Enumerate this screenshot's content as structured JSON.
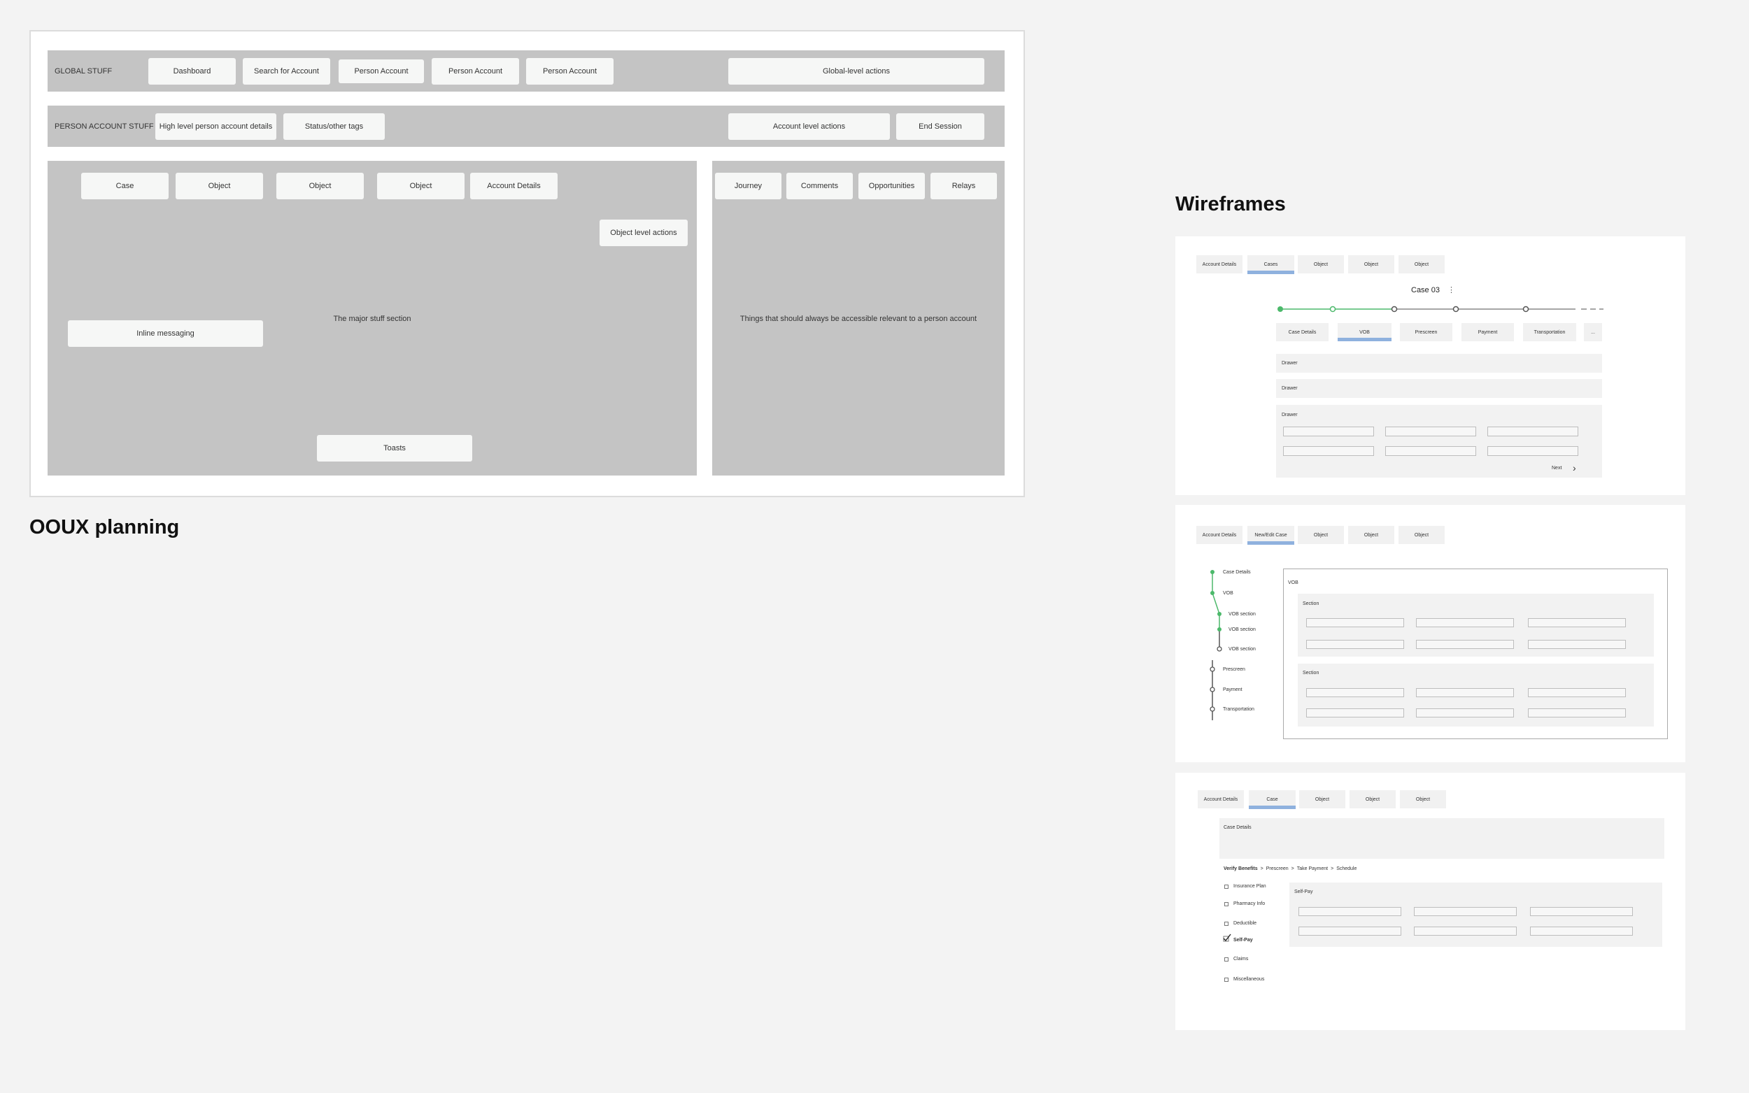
{
  "ooux": {
    "heading": "OOUX planning",
    "global": {
      "label": "GLOBAL STUFF",
      "items": [
        "Dashboard",
        "Search for Account",
        "Person Account",
        "Person Account",
        "Person Account"
      ],
      "actions": "Global-level actions"
    },
    "account": {
      "label": "PERSON ACCOUNT STUFF",
      "details": "High level person account details",
      "tags": "Status/other tags",
      "actions": "Account level actions",
      "end": "End Session"
    },
    "major": {
      "tabs": [
        "Case",
        "Object",
        "Object",
        "Object",
        "Account Details"
      ],
      "object_actions": "Object level actions",
      "inline": "Inline messaging",
      "title": "The major stuff section",
      "toasts": "Toasts"
    },
    "side": {
      "tabs": [
        "Journey",
        "Comments",
        "Opportunities",
        "Relays"
      ],
      "title": "Things that should always be accessible relevant to a person account"
    }
  },
  "wireframes": {
    "heading": "Wireframes",
    "wf1": {
      "tabs": [
        "Account Details",
        "Cases",
        "Object",
        "Object",
        "Object"
      ],
      "case_title": "Case 03",
      "kebab": "⋮",
      "subtabs": [
        "Case Details",
        "VOB",
        "Prescreen",
        "Payment",
        "Transportation",
        "..."
      ],
      "drawers": [
        "Drawer",
        "Drawer",
        "Drawer"
      ],
      "next": "Next",
      "chevron": "›"
    },
    "wf2": {
      "tabs": [
        "Account Details",
        "New/Edit Case",
        "Object",
        "Object",
        "Object"
      ],
      "steps": [
        "Case Details",
        "VOB",
        "VOB section",
        "VOB section",
        "VOB section",
        "Prescreen",
        "Payment",
        "Transportation"
      ],
      "panel_title": "VOB",
      "sections": [
        "Section",
        "Section"
      ]
    },
    "wf3": {
      "tabs": [
        "Account Details",
        "Case",
        "Object",
        "Object",
        "Object"
      ],
      "case_details": "Case Details",
      "breadcrumb": [
        "Verify Benefits",
        ">",
        "Prescreen",
        ">",
        "Take Payment",
        ">",
        "Schedule"
      ],
      "checklist": [
        "Insurance Plan",
        "Pharmacy Info",
        "Deductible",
        "Self-Pay",
        "Claims",
        "Miscellaneous"
      ],
      "panel_title": "Self-Pay"
    }
  },
  "colors": {
    "accent_green": "#4cb96b",
    "accent_blue": "#8fb1de",
    "band_gray": "#c4c4c4"
  }
}
